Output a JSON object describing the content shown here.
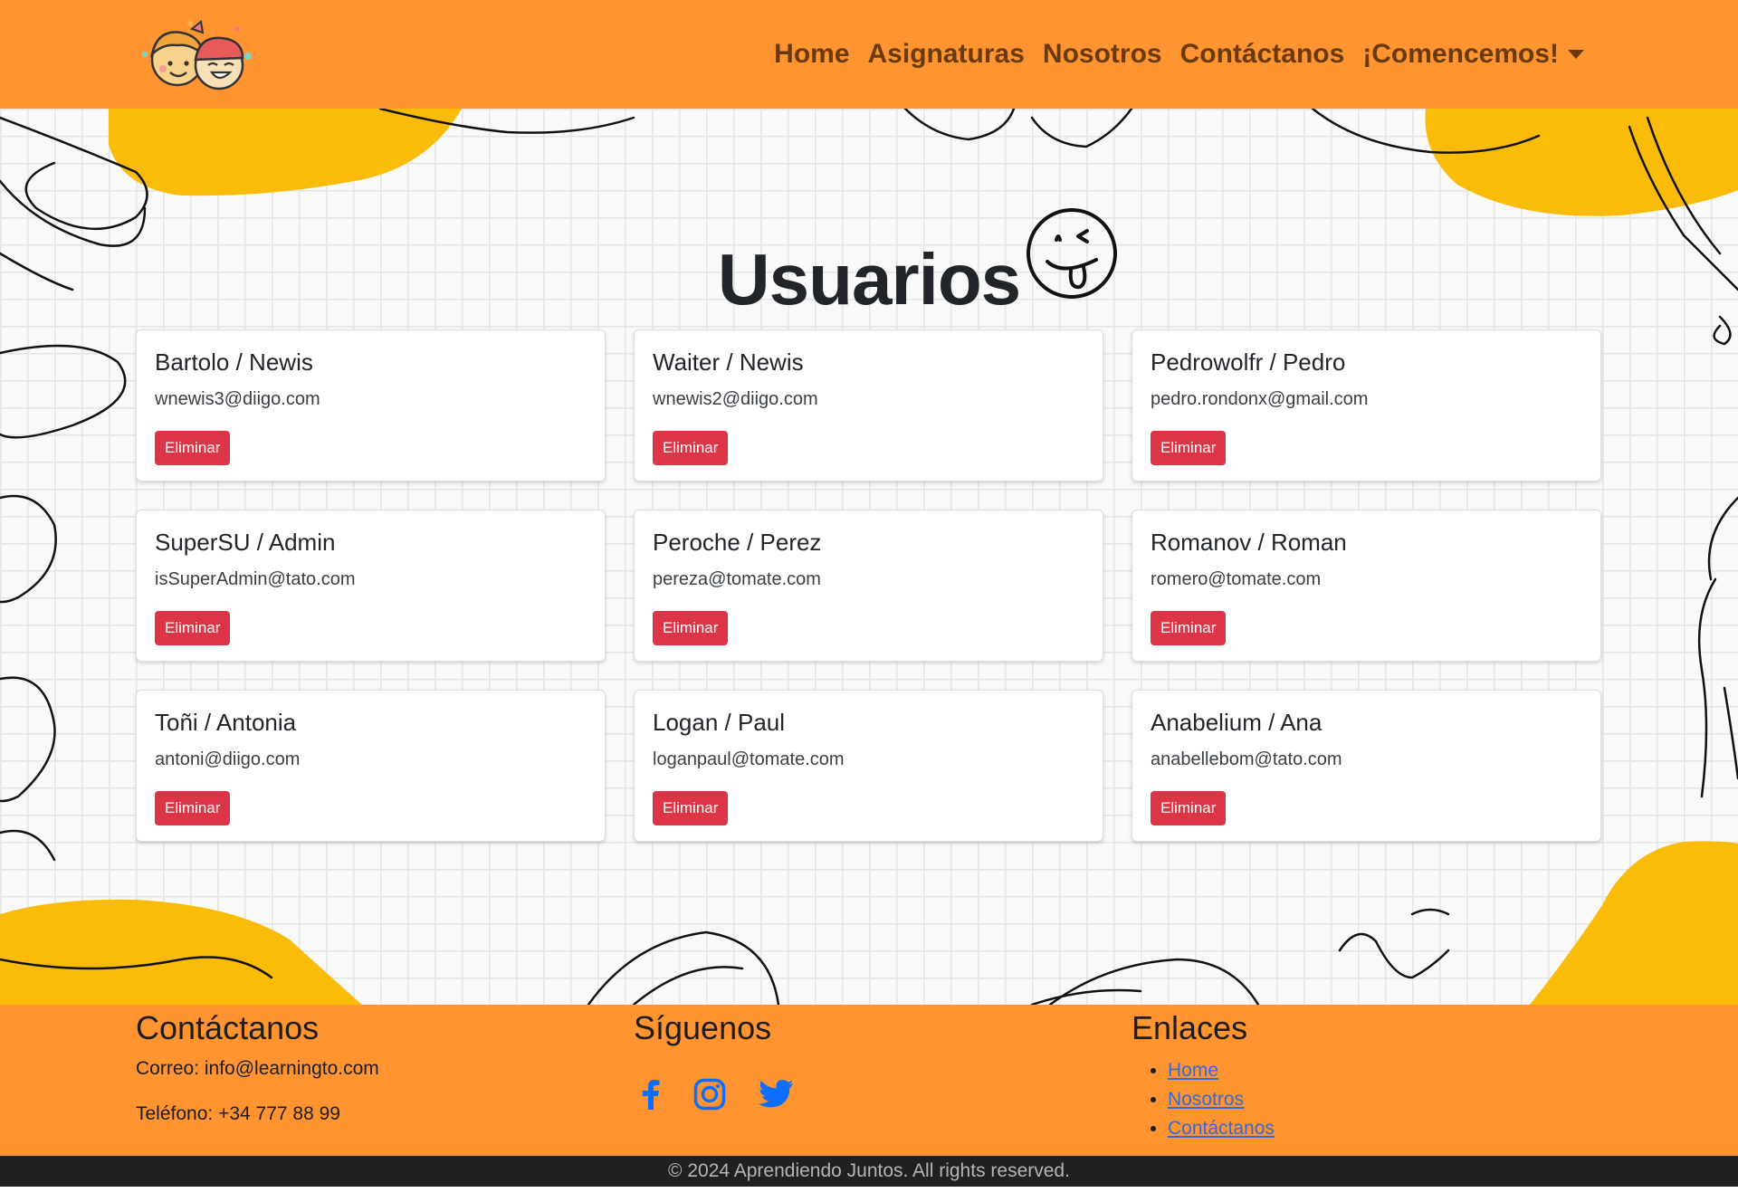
{
  "nav": {
    "logo_icon": "kids-faces-logo",
    "links": [
      "Home",
      "Asignaturas",
      "Nosotros",
      "Contáctanos",
      "¡Comencemos!"
    ]
  },
  "page": {
    "title": "Usuarios",
    "title_icon": "smiley-tongue-icon"
  },
  "users": [
    {
      "name": "Bartolo / Newis",
      "email": "wnewis3@diigo.com",
      "button": "Eliminar"
    },
    {
      "name": "Waiter / Newis",
      "email": "wnewis2@diigo.com",
      "button": "Eliminar"
    },
    {
      "name": "Pedrowolfr / Pedro",
      "email": "pedro.rondonx@gmail.com",
      "button": "Eliminar"
    },
    {
      "name": "SuperSU / Admin",
      "email": "isSuperAdmin@tato.com",
      "button": "Eliminar"
    },
    {
      "name": "Peroche / Perez",
      "email": "pereza@tomate.com",
      "button": "Eliminar"
    },
    {
      "name": "Romanov / Roman",
      "email": "romero@tomate.com",
      "button": "Eliminar"
    },
    {
      "name": "Toñi / Antonia",
      "email": "antoni@diigo.com",
      "button": "Eliminar"
    },
    {
      "name": "Logan / Paul",
      "email": "loganpaul@tomate.com",
      "button": "Eliminar"
    },
    {
      "name": "Anabelium / Ana",
      "email": "anabellebom@tato.com",
      "button": "Eliminar"
    }
  ],
  "footer": {
    "contact": {
      "title": "Contáctanos",
      "email": "Correo: info@learningto.com",
      "phone": "Teléfono: +34 777 88 99"
    },
    "social": {
      "title": "Síguenos",
      "icons": [
        "facebook-icon",
        "instagram-icon",
        "twitter-icon"
      ]
    },
    "links": {
      "title": "Enlaces",
      "items": [
        "Home",
        "Nosotros",
        "Contáctanos"
      ]
    },
    "copyright": "© 2024 Aprendiendo Juntos. All rights reserved."
  },
  "colors": {
    "brand_orange": "#FF9430",
    "danger": "#dc3545",
    "blob_yellow": "#FBBC09",
    "link_blue": "#2f6bdc",
    "social_blue": "#0d6efd"
  }
}
